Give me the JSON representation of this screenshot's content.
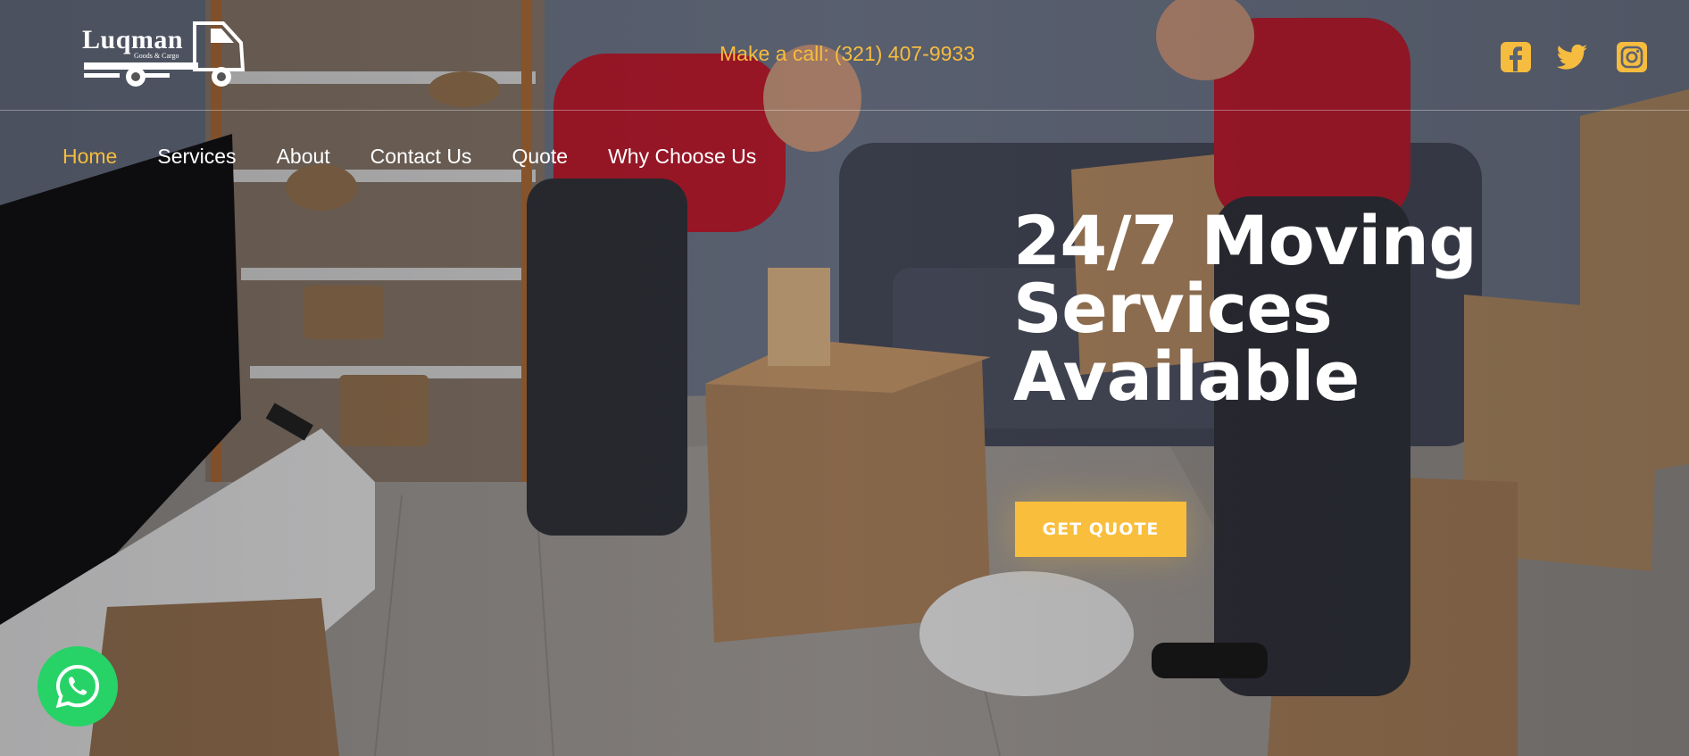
{
  "brand": {
    "name": "Luqman",
    "tagline": "Goods & Cargo"
  },
  "header": {
    "phone_label": "Make a call:",
    "phone_number": "(321) 407-9933",
    "social": [
      {
        "icon": "facebook-icon"
      },
      {
        "icon": "twitter-icon"
      },
      {
        "icon": "instagram-icon"
      }
    ]
  },
  "nav": {
    "items": [
      {
        "label": "Home",
        "active": true
      },
      {
        "label": "Services",
        "active": false
      },
      {
        "label": "About",
        "active": false
      },
      {
        "label": "Contact Us",
        "active": false
      },
      {
        "label": "Quote",
        "active": false
      },
      {
        "label": "Why Choose Us",
        "active": false
      }
    ]
  },
  "hero": {
    "headline_lines": [
      "24/7 Moving",
      "Services",
      "Available"
    ],
    "cta_label": "GET QUOTE"
  },
  "floating": {
    "whatsapp_icon": "whatsapp-icon"
  },
  "colors": {
    "accent": "#f6bc3f",
    "whatsapp": "#27d367",
    "text": "#ffffff"
  }
}
